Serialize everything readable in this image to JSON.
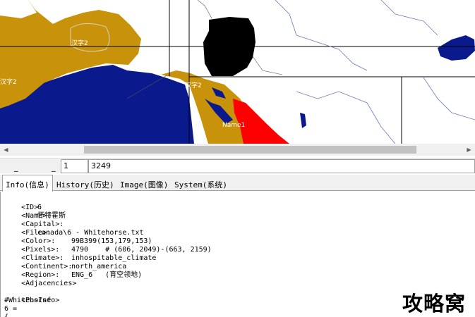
{
  "map": {
    "labels": [
      "汉字2",
      "汉字2",
      "汉字2",
      "Name1"
    ]
  },
  "coordbar": {
    "dash_left": "_",
    "dash_right": "_",
    "field1": "1",
    "field2": "3249"
  },
  "tabs": [
    {
      "label": "Info(信息)"
    },
    {
      "label": "History(历史)"
    },
    {
      "label": "Image(图像)"
    },
    {
      "label": "System(系统)"
    }
  ],
  "info": {
    "id_key": "<ID>:",
    "id_val": "6",
    "name_key": "<Name>:",
    "name_val": "怀特霍斯",
    "capital_key": "<Capital>:",
    "file_key": "<File>:",
    "file_val": "canada\\6 - Whitehorse.txt",
    "color_key": "<Color>:",
    "color_val": "99B399(153,179,153)",
    "pixels_key": "<Pixels>:",
    "pixels_val": "4790    # (606, 2049)-(663, 2159)",
    "climate_key": "<Climate>:",
    "climate_val": "inhospitable_climate",
    "continent_key": "<Continent>:",
    "continent_val": "north_america",
    "region_key": "<Region>:",
    "region_val": "ENG_6   (育空领地)",
    "adjacencies_key": "<Adjacencies>",
    "posinfo_key": "<PosInfo>",
    "posinfo_line1": "#Whitehorse",
    "posinfo_line2": "6 =",
    "posinfo_line3": "{"
  },
  "watermark": "攻略窝",
  "colors": {
    "ocean": "#0a1a8c",
    "land_gold": "#c8920a",
    "selected": "#000000",
    "highlight": "#ff0000",
    "scroll_thumb": "#c2c2c2"
  }
}
